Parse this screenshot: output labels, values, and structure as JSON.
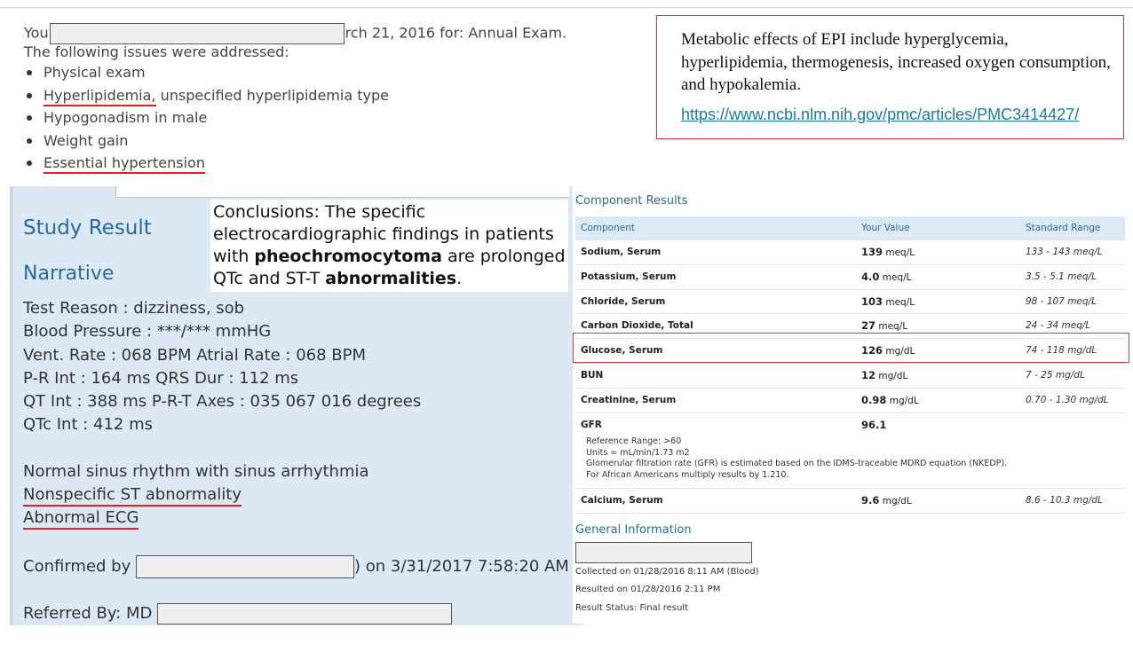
{
  "visit": {
    "prefix": "You",
    "suffix": "rch 21, 2016 for: Annual Exam.",
    "intro": "The following issues were addressed:",
    "issues": [
      {
        "text": "Physical exam"
      },
      {
        "underlined": "Hyperlipidemia,",
        "rest": " unspecified hyperlipidemia type"
      },
      {
        "text": "Hypogonadism in male"
      },
      {
        "text": "Weight gain"
      },
      {
        "underlined": "Essential hypertension",
        "rest": ""
      }
    ]
  },
  "epi_note": {
    "text": "Metabolic effects of EPI include hyperglycemia, hyperlipidemia, thermogenesis, increased oxygen consumption, and hypokalemia.",
    "link": "https://www.ncbi.nlm.nih.gov/pmc/articles/PMC3414427/"
  },
  "study": {
    "title": "Study Result",
    "narrative": "Narrative",
    "conclusion": {
      "part1": "Conclusions: The specific electrocardiographic findings in patients with ",
      "bold1": "pheochromocytoma",
      "part2": " are prolonged QTc and ST-T ",
      "bold2": "abnormalities",
      "part3": "."
    },
    "lines": [
      "Test Reason : dizziness, sob",
      "Blood Pressure : ***/*** mmHG",
      "Vent. Rate : 068 BPM Atrial Rate : 068 BPM",
      "P-R Int : 164 ms QRS Dur : 112 ms",
      "QT Int : 388 ms P-R-T Axes : 035 067 016 degrees",
      "QTc Int : 412 ms"
    ],
    "findings": [
      "Normal sinus rhythm with sinus arrhythmia",
      "Nonspecific ST abnormality",
      "Abnormal ECG"
    ],
    "confirmed_prefix": "Confirmed by",
    "confirmed_suffix": ") on 3/31/2017 7:58:20 AM",
    "referred": "Referred By: MD"
  },
  "components": {
    "header": "Component Results",
    "columns": [
      "Component",
      "Your Value",
      "Standard Range"
    ],
    "rows": [
      {
        "name": "Sodium, Serum",
        "value": "139",
        "unit": "meq/L",
        "range": "133 - 143 meq/L"
      },
      {
        "name": "Potassium, Serum",
        "value": "4.0",
        "unit": "meq/L",
        "range": "3.5 - 5.1 meq/L"
      },
      {
        "name": "Chloride, Serum",
        "value": "103",
        "unit": "meq/L",
        "range": "98 - 107 meq/L"
      },
      {
        "name": "Carbon Dioxide, Total",
        "value": "27",
        "unit": "meq/L",
        "range": "24 - 34 meq/L"
      },
      {
        "name": "Glucose, Serum",
        "value": "126",
        "unit": "mg/dL",
        "range": "74 - 118 mg/dL"
      },
      {
        "name": "BUN",
        "value": "12",
        "unit": "mg/dL",
        "range": "7 - 25 mg/dL"
      },
      {
        "name": "Creatinine, Serum",
        "value": "0.98",
        "unit": "mg/dL",
        "range": "0.70 - 1.30 mg/dL"
      },
      {
        "name": "GFR",
        "value": "96.1",
        "unit": "",
        "range": ""
      }
    ],
    "gfr_notes": [
      "Reference Range: >60",
      "Units = mL/min/1.73 m2",
      "Glomerular filtration rate (GFR) is estimated based on the IDMS-traceable MDRD equation (NKEDP).",
      "For African Americans multiply results by 1.210."
    ],
    "calcium": {
      "name": "Calcium, Serum",
      "value": "9.6",
      "unit": "mg/dL",
      "range": "8.6 - 10.3 mg/dL"
    }
  },
  "general": {
    "header": "General Information",
    "collected": "Collected on 01/28/2016 8:11 AM (Blood)",
    "resulted": "Resulted on 01/28/2016 2:11 PM",
    "status": "Result Status: Final result"
  }
}
